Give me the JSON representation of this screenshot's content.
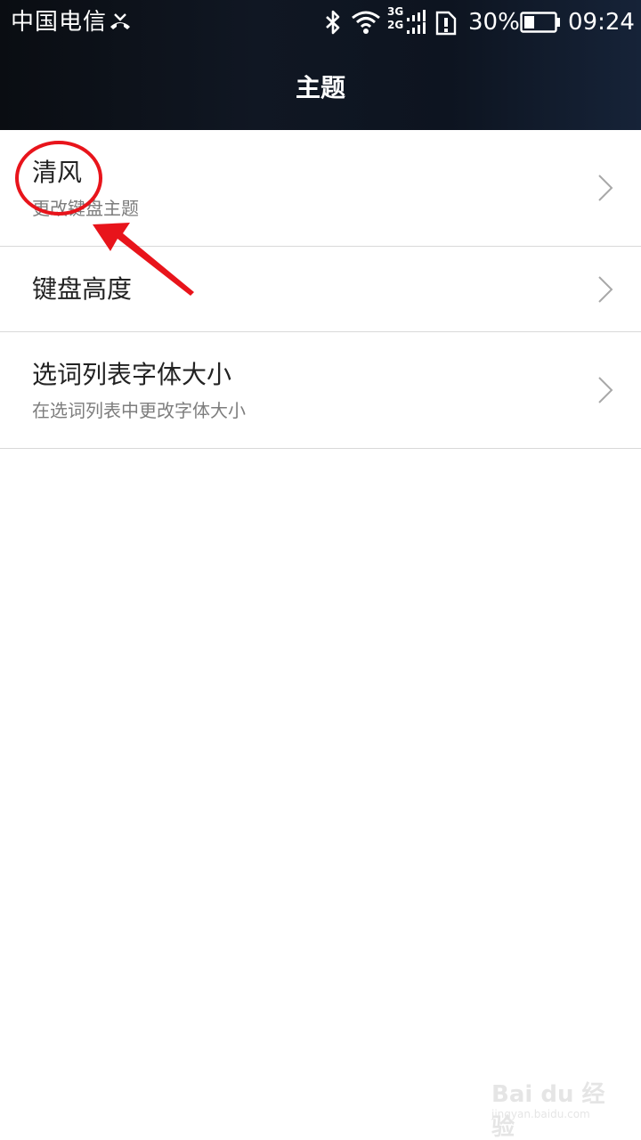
{
  "status_bar": {
    "carrier": "中国电信",
    "network_top": "3G",
    "network_bottom": "2G",
    "battery": "30%",
    "time": "09:24"
  },
  "header": {
    "title": "主题"
  },
  "settings": {
    "items": [
      {
        "title": "清风",
        "subtitle": "更改键盘主题"
      },
      {
        "title": "键盘高度"
      },
      {
        "title": "选词列表字体大小",
        "subtitle": "在选词列表中更改字体大小"
      }
    ]
  },
  "watermark": {
    "brand": "Bai du 经验",
    "url": "jingyan.baidu.com"
  },
  "colors": {
    "header_bg": "#0f1622",
    "annotation": "#e8141b",
    "divider": "#d9d9d9"
  }
}
